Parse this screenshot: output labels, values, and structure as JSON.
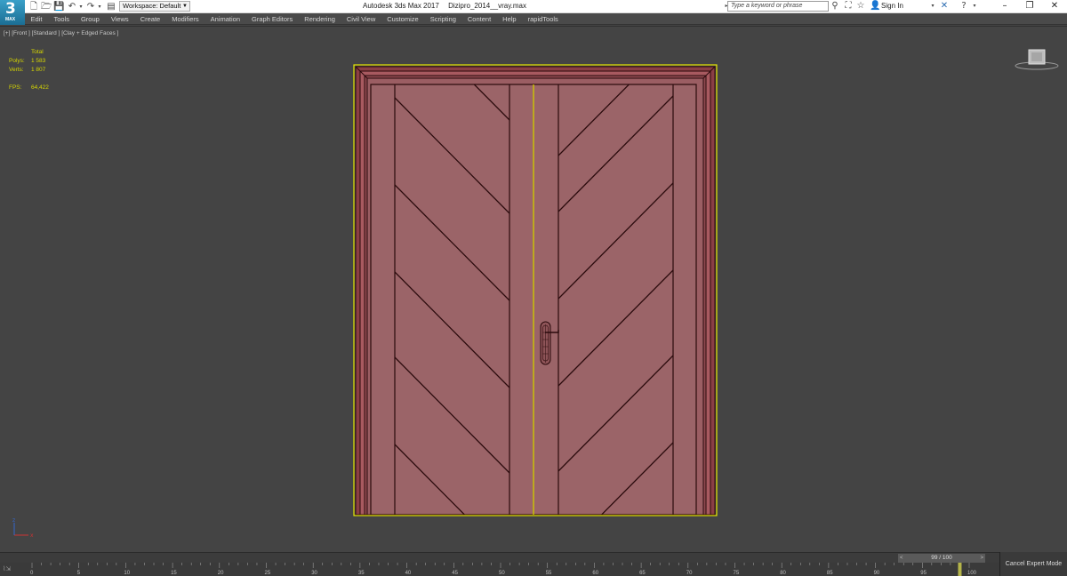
{
  "app": {
    "logo_number": "3",
    "logo_text": "MAX",
    "title": "Autodesk 3ds Max 2017",
    "filename": "Dizipro_2014__vray.max"
  },
  "toolbar": {
    "workspace_label": "Workspace: Default",
    "search_placeholder": "Type a keyword or phrase",
    "sign_in_label": "Sign In"
  },
  "menu": [
    "Edit",
    "Tools",
    "Group",
    "Views",
    "Create",
    "Modifiers",
    "Animation",
    "Graph Editors",
    "Rendering",
    "Civil View",
    "Customize",
    "Scripting",
    "Content",
    "Help",
    "rapidTools"
  ],
  "viewport": {
    "label": "[+] [Front ] [Standard ] [Clay + Edged Faces ]",
    "stats": {
      "header": "Total",
      "polys_label": "Polys:",
      "polys_value": "1 583",
      "verts_label": "Verts:",
      "verts_value": "1 807",
      "fps_label": "FPS:",
      "fps_value": "64,422"
    },
    "colors": {
      "background": "#444444",
      "door_fill": "#9b6468",
      "door_edge": "#2a0a0c",
      "selection": "#e8e800",
      "stats_text": "#d6d600"
    }
  },
  "timeline": {
    "frame_display": "99 / 100",
    "current_frame": 99,
    "total_frames": 100,
    "ticks": [
      "0",
      "5",
      "10",
      "15",
      "20",
      "25",
      "30",
      "35",
      "40",
      "45",
      "50",
      "55",
      "60",
      "65",
      "70",
      "75",
      "80",
      "85",
      "90",
      "95",
      "100"
    ]
  },
  "status": {
    "cancel_expert_label": "Cancel Expert Mode"
  }
}
